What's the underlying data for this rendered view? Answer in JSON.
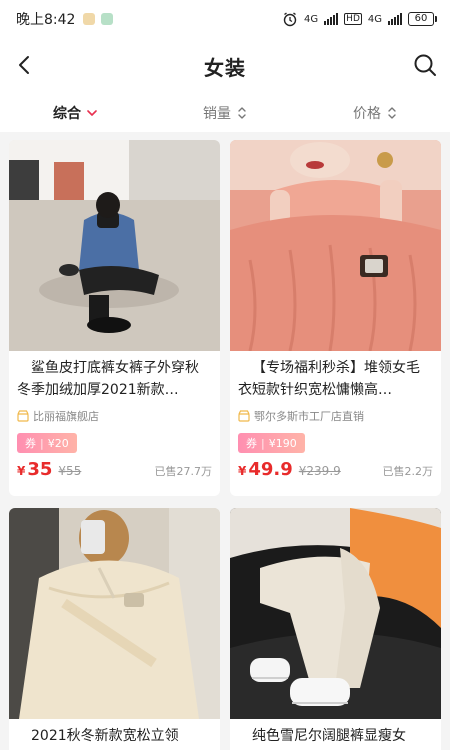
{
  "status_bar": {
    "time": "晚上8:42",
    "network1": "4G",
    "network2": "4G",
    "hd": "HD",
    "battery": "60"
  },
  "header": {
    "title": "女装"
  },
  "sort_bar": {
    "items": [
      {
        "label": "综合"
      },
      {
        "label": "销量"
      },
      {
        "label": "价格"
      }
    ]
  },
  "products": [
    {
      "name": "鲨鱼皮打底裤女裤子外穿秋冬季加绒加厚2021新款…",
      "shop": "比丽福旗舰店",
      "coupon": "券",
      "coupon_value": "¥20",
      "price_symbol": "¥",
      "price": "35",
      "original_price": "¥55",
      "sold": "已售27.7万"
    },
    {
      "name": "【专场福利秒杀】堆领女毛衣短款针织宽松慵懒高…",
      "shop": "鄂尔多斯市工厂店直销",
      "coupon": "券",
      "coupon_value": "¥190",
      "price_symbol": "¥",
      "price": "49.9",
      "original_price": "¥239.9",
      "sold": "已售2.2万"
    },
    {
      "name": "2021秋冬新款宽松立领"
    },
    {
      "name": "纯色雪尼尔阔腿裤显瘦女"
    }
  ],
  "colors": {
    "price": "#e82b2b",
    "coupon_start": "#ff8fb1",
    "coupon_end": "#ffb3a8",
    "active_sort_arrow": "#e8304f"
  }
}
